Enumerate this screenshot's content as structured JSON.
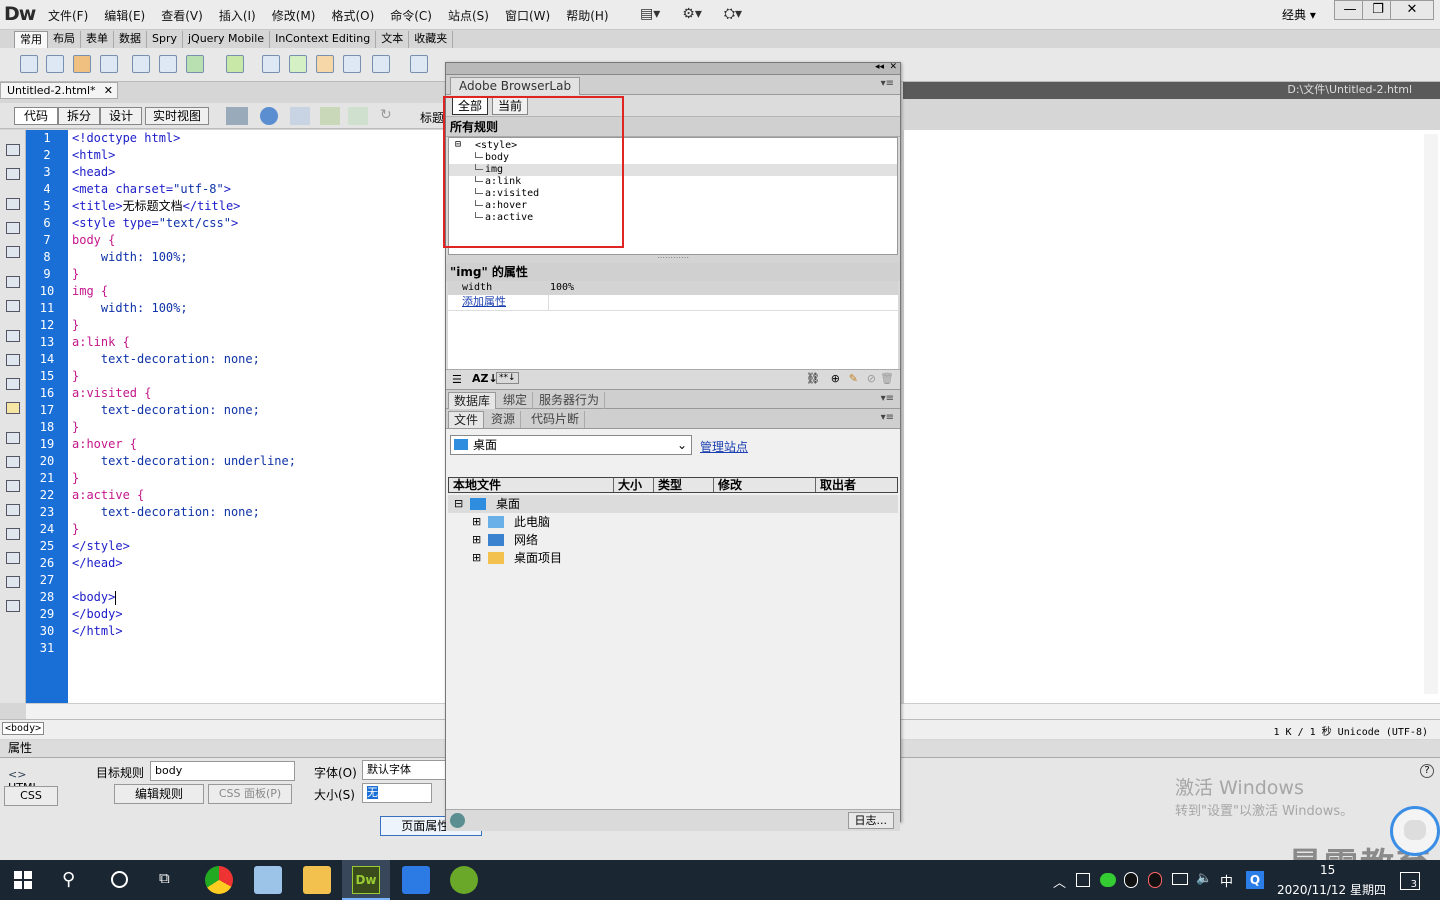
{
  "app": {
    "logo": "Dw",
    "layout_label": "经典",
    "layout_arrow": "▾",
    "min": "—",
    "restore": "❐",
    "close": "✕"
  },
  "menu": [
    "文件(F)",
    "编辑(E)",
    "查看(V)",
    "插入(I)",
    "修改(M)",
    "格式(O)",
    "命令(C)",
    "站点(S)",
    "窗口(W)",
    "帮助(H)"
  ],
  "insert_tabs": [
    "常用",
    "布局",
    "表单",
    "数据",
    "Spry",
    "jQuery Mobile",
    "InContext Editing",
    "文本",
    "收藏夹"
  ],
  "document": {
    "tab": "Untitled-2.html*",
    "close": "✕",
    "path": "D:\\文件\\Untitled-2.html"
  },
  "view_buttons": [
    "代码",
    "拆分",
    "设计",
    "实时视图"
  ],
  "title_label": "标题",
  "code_lines": [
    [
      [
        "tag",
        "<!doctype html>"
      ]
    ],
    [
      [
        "tag",
        "<html>"
      ]
    ],
    [
      [
        "tag",
        "<head>"
      ]
    ],
    [
      [
        "tag",
        "<meta charset="
      ],
      [
        "str",
        "\"utf-8\""
      ],
      [
        "tag",
        ">"
      ]
    ],
    [
      [
        "tag",
        "<title>"
      ],
      [
        "txt",
        "无标题文档"
      ],
      [
        "tag",
        "</title>"
      ]
    ],
    [
      [
        "tag",
        "<style type="
      ],
      [
        "str",
        "\"text/css\""
      ],
      [
        "tag",
        ">"
      ]
    ],
    [
      [
        "sel",
        "body {"
      ]
    ],
    [
      [
        "txt",
        "    "
      ],
      [
        "prop",
        "width: 100%;"
      ]
    ],
    [
      [
        "sel",
        "}"
      ]
    ],
    [
      [
        "sel",
        "img {"
      ]
    ],
    [
      [
        "txt",
        "    "
      ],
      [
        "prop",
        "width: 100%;"
      ]
    ],
    [
      [
        "sel",
        "}"
      ]
    ],
    [
      [
        "sel",
        "a:link {"
      ]
    ],
    [
      [
        "txt",
        "    "
      ],
      [
        "prop",
        "text-decoration: none;"
      ]
    ],
    [
      [
        "sel",
        "}"
      ]
    ],
    [
      [
        "sel",
        "a:visited {"
      ]
    ],
    [
      [
        "txt",
        "    "
      ],
      [
        "prop",
        "text-decoration: none;"
      ]
    ],
    [
      [
        "sel",
        "}"
      ]
    ],
    [
      [
        "sel",
        "a:hover {"
      ]
    ],
    [
      [
        "txt",
        "    "
      ],
      [
        "prop",
        "text-decoration: underline;"
      ]
    ],
    [
      [
        "sel",
        "}"
      ]
    ],
    [
      [
        "sel",
        "a:active {"
      ]
    ],
    [
      [
        "txt",
        "    "
      ],
      [
        "prop",
        "text-decoration: none;"
      ]
    ],
    [
      [
        "sel",
        "}"
      ]
    ],
    [
      [
        "tag",
        "</style>"
      ]
    ],
    [
      [
        "tag",
        "</head>"
      ]
    ],
    [
      [
        "txt",
        ""
      ]
    ],
    [
      [
        "tag",
        "<body>"
      ]
    ],
    [
      [
        "tag",
        "</body>"
      ]
    ],
    [
      [
        "tag",
        "</html>"
      ]
    ],
    [
      [
        "txt",
        ""
      ]
    ]
  ],
  "status": {
    "tag": "<body>",
    "info": "1 K / 1 秒  Unicode (UTF-8)"
  },
  "panel": {
    "title": "Adobe BrowserLab",
    "collapse": "◂◂",
    "close": "✕",
    "panel_menu": "▾≡",
    "css_buttons": [
      "全部",
      "当前"
    ],
    "rules_header": "所有规则",
    "rules": [
      "<style>",
      "body",
      "img",
      "a:link",
      "a:visited",
      "a:hover",
      "a:active"
    ],
    "prop_header": "\"img\" 的属性",
    "prop_name": "width",
    "prop_value": "100%",
    "add_property": "添加属性",
    "group_tabs": [
      "数据库",
      "绑定",
      "服务器行为"
    ],
    "file_tabs": [
      "文件",
      "资源",
      "代码片断"
    ],
    "site_select": "桌面",
    "manage_sites": "管理站点",
    "file_columns": [
      "本地文件",
      "大小",
      "类型",
      "修改",
      "取出者"
    ],
    "files": [
      {
        "name": "桌面",
        "expander": "⊟"
      },
      {
        "name": "此电脑",
        "expander": "⊞"
      },
      {
        "name": "网络",
        "expander": "⊞"
      },
      {
        "name": "桌面项目",
        "expander": "⊞"
      }
    ],
    "log_button": "日志..."
  },
  "properties": {
    "header": "属性",
    "html_btn": "HTML",
    "css_btn": "CSS",
    "target_rule_label": "目标规则",
    "target_rule_value": "body",
    "edit_rule": "编辑规则",
    "css_panel": "CSS 面板(P)",
    "font_label": "字体(O)",
    "font_value": "默认字体",
    "size_label": "大小(S)",
    "size_value": "无",
    "page_props": "页面属性..."
  },
  "watermark": {
    "line1": "激活 Windows",
    "line2": "转到\"设置\"以激活 Windows。",
    "brand": "最需教育"
  },
  "taskbar": {
    "ime": "中",
    "time_partial": "15",
    "date": "2020/11/12 星期四",
    "notif": "3",
    "q_badge": "Q"
  }
}
